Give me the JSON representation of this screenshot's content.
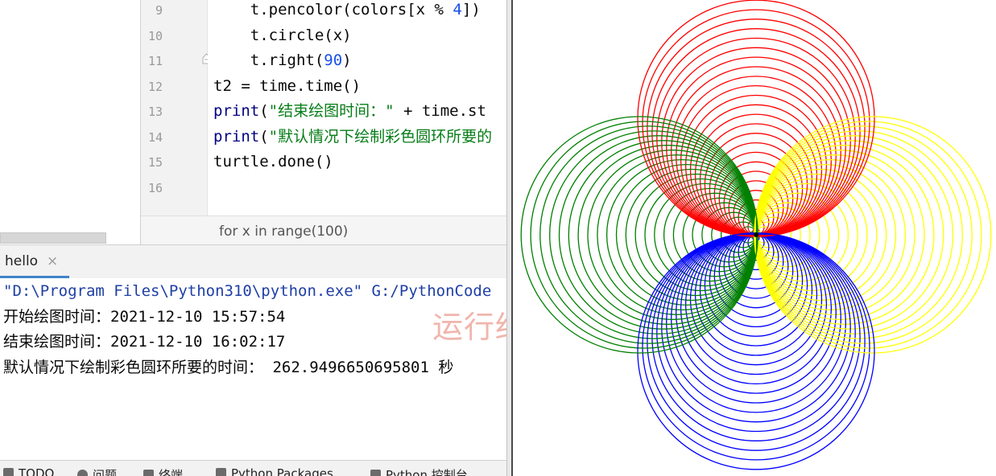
{
  "editor": {
    "line_numbers": [
      "9",
      "10",
      "11",
      "12",
      "13",
      "14",
      "15",
      "16"
    ],
    "lines": [
      [
        {
          "t": "    t.pencolor(colors[x % "
        },
        {
          "t": "4",
          "c": "num"
        },
        {
          "t": "])"
        }
      ],
      [
        {
          "t": "    t.circle(x)"
        }
      ],
      [
        {
          "t": "    t.right("
        },
        {
          "t": "90",
          "c": "num"
        },
        {
          "t": ")"
        }
      ],
      [
        {
          "t": "t2 = time.time()"
        }
      ],
      [
        {
          "t": "print",
          "c": "fn"
        },
        {
          "t": "("
        },
        {
          "t": "\"结束绘图时间：\"",
          "c": "str"
        },
        {
          "t": " + time.st"
        }
      ],
      [
        {
          "t": "print",
          "c": "fn"
        },
        {
          "t": "("
        },
        {
          "t": "\"默认情况下绘制彩色圆环所要的",
          "c": "str"
        }
      ],
      [
        {
          "t": "turtle.done()"
        }
      ],
      []
    ],
    "breadcrumb": "for x in range(100)"
  },
  "run_panel": {
    "tab_label": "hello",
    "tab_close": "×",
    "output": [
      {
        "text": "\"D:\\Program Files\\Python310\\python.exe\" G:/PythonCode",
        "style": "cmd"
      },
      {
        "text": "开始绘图时间：2021-12-10 15:57:54"
      },
      {
        "text": "结束绘图时间：2021-12-10 16:02:17"
      },
      {
        "text": "默认情况下绘制彩色圆环所要的时间： 262.9496650695801 秒"
      }
    ],
    "watermark": "运行结果"
  },
  "bottom_bar": {
    "items": [
      {
        "label": "TODO",
        "icon": "list-icon"
      },
      {
        "label": "问题",
        "icon": "problems-icon"
      },
      {
        "label": "终端",
        "icon": "terminal-icon"
      },
      {
        "label": "Python Packages",
        "icon": "packages-icon"
      },
      {
        "label": "Python 控制台",
        "icon": "python-console-icon"
      }
    ]
  },
  "turtle_canvas": {
    "colors": [
      "#ff0000",
      "#ffff00",
      "#0000ff",
      "#008000"
    ],
    "rings_per_color": 25
  }
}
